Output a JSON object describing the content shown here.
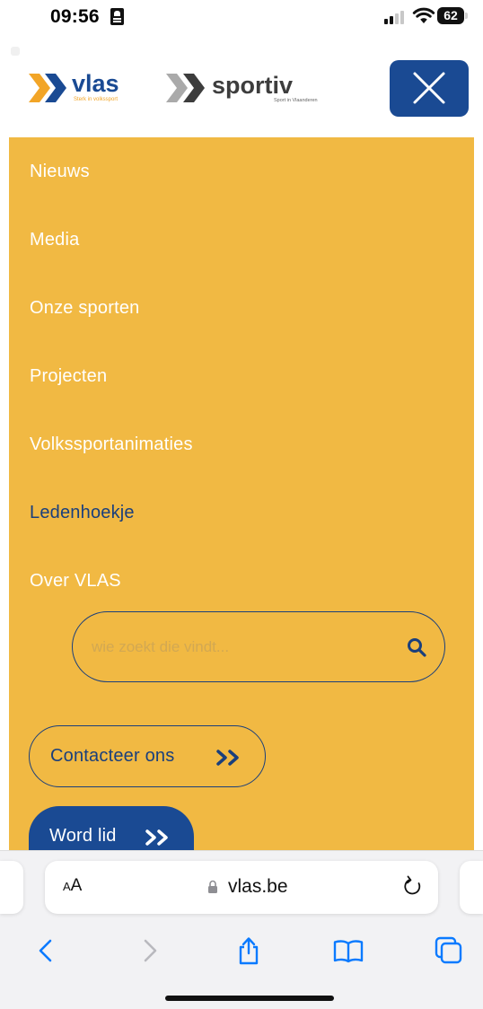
{
  "status_bar": {
    "time": "09:56",
    "battery": "62"
  },
  "header": {
    "logo_vlas": {
      "name": "vlas",
      "tagline": "Sterk in volkssport"
    },
    "logo_sportiv": {
      "name": "sportiv",
      "tagline": "Sport in Vlaanderen"
    },
    "close_icon": "close-icon"
  },
  "menu": {
    "items": [
      {
        "label": "Nieuws",
        "active": false
      },
      {
        "label": "Media",
        "active": false
      },
      {
        "label": "Onze sporten",
        "active": false
      },
      {
        "label": "Projecten",
        "active": false
      },
      {
        "label": "Volkssportanimaties",
        "active": false
      },
      {
        "label": "Ledenhoekje",
        "active": true
      },
      {
        "label": "Over VLAS",
        "active": false
      }
    ],
    "search": {
      "placeholder": "wie zoekt die vindt...",
      "value": ""
    },
    "contact_label": "Contacteer ons",
    "member_label": "Word lid"
  },
  "browser": {
    "aa_label_small": "A",
    "aa_label_large": "A",
    "url": "vlas.be"
  },
  "colors": {
    "menu_background": "#f1b943",
    "brand_blue": "#1a4a93",
    "active_text": "#1a3f7c",
    "vlas_orange": "#f2a527",
    "safari_blue": "#0a7aff"
  }
}
